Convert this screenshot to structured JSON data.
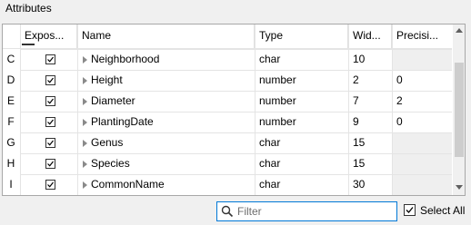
{
  "section_title": "Attributes",
  "columns": {
    "exposed": "Expos...",
    "name": "Name",
    "type": "Type",
    "width": "Wid...",
    "precision": "Precisi..."
  },
  "rows": [
    {
      "label": "C",
      "exposed": true,
      "name": "Neighborhood",
      "type": "char",
      "width": "10",
      "precision": ""
    },
    {
      "label": "D",
      "exposed": true,
      "name": "Height",
      "type": "number",
      "width": "2",
      "precision": "0"
    },
    {
      "label": "E",
      "exposed": true,
      "name": "Diameter",
      "type": "number",
      "width": "7",
      "precision": "2"
    },
    {
      "label": "F",
      "exposed": true,
      "name": "PlantingDate",
      "type": "number",
      "width": "9",
      "precision": "0"
    },
    {
      "label": "G",
      "exposed": true,
      "name": "Genus",
      "type": "char",
      "width": "15",
      "precision": ""
    },
    {
      "label": "H",
      "exposed": true,
      "name": "Species",
      "type": "char",
      "width": "15",
      "precision": ""
    },
    {
      "label": "I",
      "exposed": true,
      "name": "CommonName",
      "type": "char",
      "width": "30",
      "precision": ""
    }
  ],
  "filter": {
    "placeholder": "Filter",
    "value": ""
  },
  "select_all": {
    "label": "Select All",
    "checked": true
  },
  "colors": {
    "focus_border": "#0078d7",
    "grid_border": "#a8a8a8",
    "disabled_cell": "#efefef"
  }
}
